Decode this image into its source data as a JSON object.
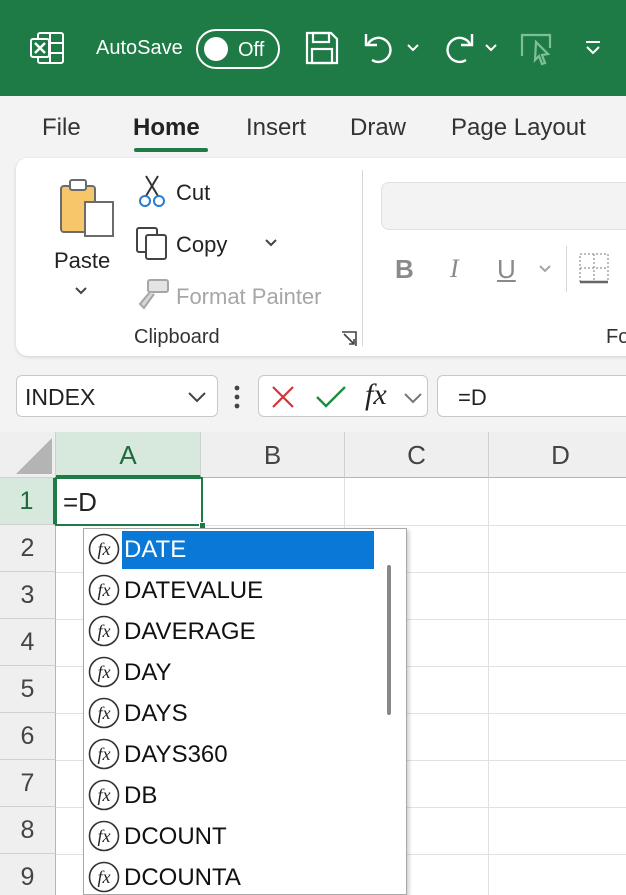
{
  "titlebar": {
    "autosave_label": "AutoSave",
    "autosave_state": "Off",
    "icons": [
      "excel-logo-icon",
      "save-icon",
      "undo-icon",
      "chevron-down-icon",
      "redo-icon",
      "chevron-down-icon",
      "touch-mode-icon",
      "customize-toolbar-icon"
    ],
    "colors": {
      "background": "#1e7b45",
      "foreground": "#ffffff"
    }
  },
  "ribbon": {
    "tabs": [
      {
        "label": "File",
        "active": false
      },
      {
        "label": "Home",
        "active": true
      },
      {
        "label": "Insert",
        "active": false
      },
      {
        "label": "Draw",
        "active": false
      },
      {
        "label": "Page Layout",
        "active": false
      }
    ],
    "clipboard": {
      "paste_label": "Paste",
      "cut_label": "Cut",
      "copy_label": "Copy",
      "format_painter_label": "Format Painter",
      "group_label": "Clipboard"
    },
    "font": {
      "bold_label": "B",
      "italic_label": "I",
      "underline_label": "U",
      "group_label_partial": "Fo"
    }
  },
  "formula_bar": {
    "name_box": "INDEX",
    "formula": "=D",
    "cancel_icon": "close-icon",
    "enter_icon": "check-icon",
    "fx_label": "fx"
  },
  "sheet": {
    "columns": [
      "A",
      "B",
      "C",
      "D"
    ],
    "rows": [
      "1",
      "2",
      "3",
      "4",
      "5",
      "6",
      "7",
      "8",
      "9"
    ],
    "active_cell": "A1",
    "active_cell_value": "=D"
  },
  "autocomplete": {
    "items": [
      "DATE",
      "DATEVALUE",
      "DAVERAGE",
      "DAY",
      "DAYS",
      "DAYS360",
      "DB",
      "DCOUNT",
      "DCOUNTA"
    ],
    "selected": "DATE",
    "colors": {
      "selected_background": "#0a78d7",
      "selected_text": "#ffffff"
    }
  }
}
